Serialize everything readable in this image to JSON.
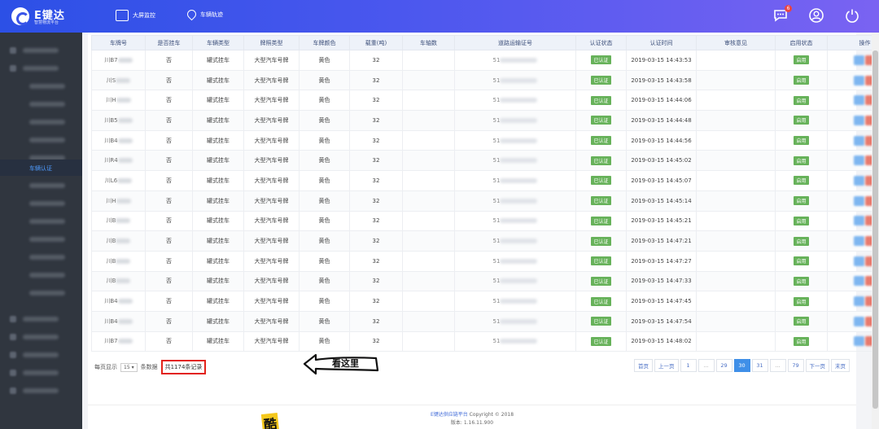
{
  "app": {
    "logo_title": "E键达",
    "logo_subtitle": "智慧物流平台"
  },
  "topnav": {
    "items": [
      {
        "label": "大屏监控",
        "icon": "monitor-icon"
      },
      {
        "label": "车辆轨迹",
        "icon": "location-icon"
      }
    ],
    "notification_count": "6",
    "icons": [
      "message-icon",
      "user-icon",
      "power-icon"
    ]
  },
  "sidebar": {
    "active_label": "车辆认证"
  },
  "table": {
    "columns": [
      "车牌号",
      "是否挂车",
      "车辆类型",
      "牌照类型",
      "车牌颜色",
      "载重(吨)",
      "车轴数",
      "道路运输证号",
      "认证状态",
      "认证时间",
      "审核意见",
      "启用状态",
      "操作"
    ],
    "rows": [
      {
        "plate": "川B7",
        "trailer": "否",
        "type": "罐式挂车",
        "license": "大型汽车号牌",
        "color": "黄色",
        "load": "32",
        "permit": "51",
        "status": "已认证",
        "time": "2019-03-15 14:43:53",
        "enabled": "启用"
      },
      {
        "plate": "川S",
        "trailer": "否",
        "type": "罐式挂车",
        "license": "大型汽车号牌",
        "color": "黄色",
        "load": "32",
        "permit": "51",
        "status": "已认证",
        "time": "2019-03-15 14:43:58",
        "enabled": "启用"
      },
      {
        "plate": "川H",
        "trailer": "否",
        "type": "罐式挂车",
        "license": "大型汽车号牌",
        "color": "黄色",
        "load": "32",
        "permit": "51",
        "status": "已认证",
        "time": "2019-03-15 14:44:06",
        "enabled": "启用"
      },
      {
        "plate": "川B5",
        "trailer": "否",
        "type": "罐式挂车",
        "license": "大型汽车号牌",
        "color": "黄色",
        "load": "32",
        "permit": "51",
        "status": "已认证",
        "time": "2019-03-15 14:44:48",
        "enabled": "启用"
      },
      {
        "plate": "川B4",
        "trailer": "否",
        "type": "罐式挂车",
        "license": "大型汽车号牌",
        "color": "黄色",
        "load": "32",
        "permit": "51",
        "status": "已认证",
        "time": "2019-03-15 14:44:56",
        "enabled": "启用"
      },
      {
        "plate": "川R4",
        "trailer": "否",
        "type": "罐式挂车",
        "license": "大型汽车号牌",
        "color": "黄色",
        "load": "32",
        "permit": "51",
        "status": "已认证",
        "time": "2019-03-15 14:45:02",
        "enabled": "启用"
      },
      {
        "plate": "川L6",
        "trailer": "否",
        "type": "罐式挂车",
        "license": "大型汽车号牌",
        "color": "黄色",
        "load": "32",
        "permit": "51",
        "status": "已认证",
        "time": "2019-03-15 14:45:07",
        "enabled": "启用"
      },
      {
        "plate": "川H",
        "trailer": "否",
        "type": "罐式挂车",
        "license": "大型汽车号牌",
        "color": "黄色",
        "load": "32",
        "permit": "51",
        "status": "已认证",
        "time": "2019-03-15 14:45:14",
        "enabled": "启用"
      },
      {
        "plate": "川B",
        "trailer": "否",
        "type": "罐式挂车",
        "license": "大型汽车号牌",
        "color": "黄色",
        "load": "32",
        "permit": "51",
        "status": "已认证",
        "time": "2019-03-15 14:45:21",
        "enabled": "启用"
      },
      {
        "plate": "川B",
        "trailer": "否",
        "type": "罐式挂车",
        "license": "大型汽车号牌",
        "color": "黄色",
        "load": "32",
        "permit": "51",
        "status": "已认证",
        "time": "2019-03-15 14:47:21",
        "enabled": "启用"
      },
      {
        "plate": "川B",
        "trailer": "否",
        "type": "罐式挂车",
        "license": "大型汽车号牌",
        "color": "黄色",
        "load": "32",
        "permit": "51",
        "status": "已认证",
        "time": "2019-03-15 14:47:27",
        "enabled": "启用"
      },
      {
        "plate": "川B",
        "trailer": "否",
        "type": "罐式挂车",
        "license": "大型汽车号牌",
        "color": "黄色",
        "load": "32",
        "permit": "51",
        "status": "已认证",
        "time": "2019-03-15 14:47:33",
        "enabled": "启用"
      },
      {
        "plate": "川B4",
        "trailer": "否",
        "type": "罐式挂车",
        "license": "大型汽车号牌",
        "color": "黄色",
        "load": "32",
        "permit": "51",
        "status": "已认证",
        "time": "2019-03-15 14:47:45",
        "enabled": "启用"
      },
      {
        "plate": "川B4",
        "trailer": "否",
        "type": "罐式挂车",
        "license": "大型汽车号牌",
        "color": "黄色",
        "load": "32",
        "permit": "51",
        "status": "已认证",
        "time": "2019-03-15 14:47:54",
        "enabled": "启用"
      },
      {
        "plate": "川B7",
        "trailer": "否",
        "type": "罐式挂车",
        "license": "大型汽车号牌",
        "color": "黄色",
        "load": "32",
        "permit": "51",
        "status": "已认证",
        "time": "2019-03-15 14:48:02",
        "enabled": "启用"
      }
    ]
  },
  "pagination": {
    "per_page_label": "每页显示",
    "per_page_value": "15",
    "per_page_suffix": "条数据",
    "total_label": "共1174条记录",
    "first": "首页",
    "prev": "上一页",
    "pages": [
      "1",
      "...",
      "29",
      "30",
      "31",
      "...",
      "79"
    ],
    "active_page": "30",
    "next": "下一页",
    "last": "末页"
  },
  "annotations": {
    "look_here": "看这里",
    "cool": "酷"
  },
  "footer": {
    "platform_link": "E键达供应链平台",
    "copyright": "Copyright © 2018",
    "version": "版本: 1.16.11.900"
  },
  "colors": {
    "topbar_start": "#2c50e6",
    "topbar_end": "#7a63f2",
    "active_page": "#3f8fe8",
    "tag_green": "#67b25a",
    "highlight_red": "#e2231a"
  }
}
